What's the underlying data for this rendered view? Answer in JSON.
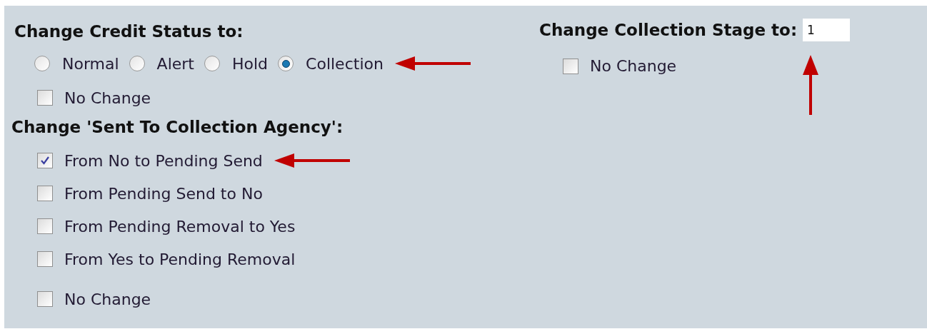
{
  "credit_status": {
    "heading": "Change Credit Status to:",
    "options": [
      {
        "label": "Normal",
        "selected": false,
        "arrow": false
      },
      {
        "label": "Alert",
        "selected": false,
        "arrow": false
      },
      {
        "label": "Hold",
        "selected": false,
        "arrow": false
      },
      {
        "label": "Collection",
        "selected": true,
        "arrow": true
      }
    ],
    "no_change": {
      "label": "No Change",
      "checked": false
    }
  },
  "collection_agency": {
    "heading": "Change 'Sent To Collection Agency':",
    "items": [
      {
        "label": "From No to Pending Send",
        "checked": true,
        "arrow": true
      },
      {
        "label": "From Pending Send to No",
        "checked": false,
        "arrow": false
      },
      {
        "label": "From Pending Removal to Yes",
        "checked": false,
        "arrow": false
      },
      {
        "label": "From Yes to Pending Removal",
        "checked": false,
        "arrow": false
      }
    ],
    "no_change": {
      "label": "No Change",
      "checked": false
    }
  },
  "collection_stage": {
    "heading": "Change Collection Stage to:",
    "value": "1",
    "arrow": true,
    "no_change": {
      "label": "No Change",
      "checked": false
    }
  }
}
